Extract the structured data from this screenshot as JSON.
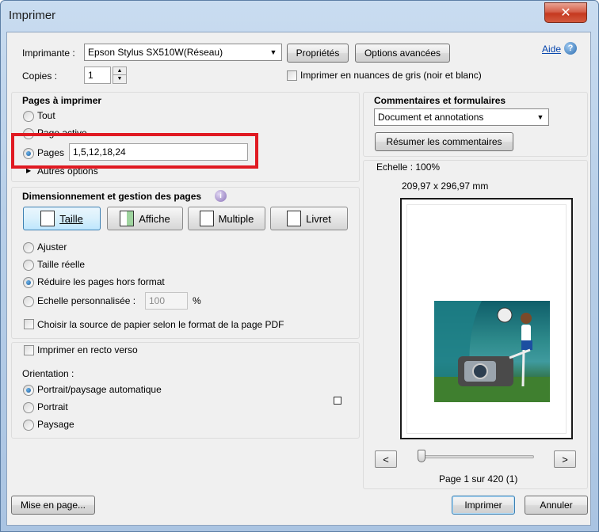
{
  "window": {
    "title": "Imprimer",
    "close_glyph": "✕"
  },
  "printer": {
    "label": "Imprimante :",
    "selected": "Epson Stylus SX510W(Réseau)",
    "properties_button": "Propriétés",
    "advanced_button": "Options avancées",
    "help_link": "Aide",
    "help_glyph": "?"
  },
  "copies": {
    "label": "Copies :",
    "value": "1"
  },
  "grayscale": {
    "label": "Imprimer en nuances de gris (noir et blanc)",
    "checked": false
  },
  "pages_to_print": {
    "title": "Pages à imprimer",
    "options": [
      {
        "label": "Tout",
        "selected": false
      },
      {
        "label": "Page active",
        "selected": false
      },
      {
        "label": "Pages",
        "selected": true
      }
    ],
    "pages_value": "1,5,12,18,24",
    "more_options": "Autres options"
  },
  "comments": {
    "title": "Commentaires et formulaires",
    "selected": "Document et annotations",
    "summary_button": "Résumer les commentaires"
  },
  "sizing": {
    "title": "Dimensionnement et gestion des pages",
    "info_glyph": "i",
    "buttons": [
      {
        "label": "Taille",
        "active": true,
        "icon": "fit-size-icon"
      },
      {
        "label": "Affiche",
        "active": false,
        "icon": "poster-icon"
      },
      {
        "label": "Multiple",
        "active": false,
        "icon": "multiple-pages-icon"
      },
      {
        "label": "Livret",
        "active": false,
        "icon": "booklet-icon"
      }
    ],
    "options": [
      {
        "label": "Ajuster",
        "selected": false
      },
      {
        "label": "Taille réelle",
        "selected": false
      },
      {
        "label": "Réduire les pages hors format",
        "selected": true
      },
      {
        "label": "Echelle personnalisée :",
        "selected": false
      }
    ],
    "scale_value": "100",
    "scale_unit": "%",
    "paper_source": {
      "label": "Choisir la source de papier selon le format de la page PDF",
      "checked": false
    }
  },
  "duplex": {
    "label": "Imprimer en recto verso",
    "checked": false
  },
  "orientation": {
    "label": "Orientation :",
    "options": [
      {
        "label": "Portrait/paysage automatique",
        "selected": true
      },
      {
        "label": "Portrait",
        "selected": false
      },
      {
        "label": "Paysage",
        "selected": false
      }
    ]
  },
  "preview": {
    "scale": "Echelle : 100%",
    "dimensions": "209,97 x 296,97 mm",
    "prev_button": "<",
    "next_button": ">",
    "page_status": "Page 1 sur 420 (1)",
    "slider_position": 0
  },
  "footer": {
    "page_setup_button": "Mise en page...",
    "print_button": "Imprimer",
    "cancel_button": "Annuler"
  },
  "colors": {
    "highlight": "#e01a22",
    "accent": "#3c7fb1"
  }
}
